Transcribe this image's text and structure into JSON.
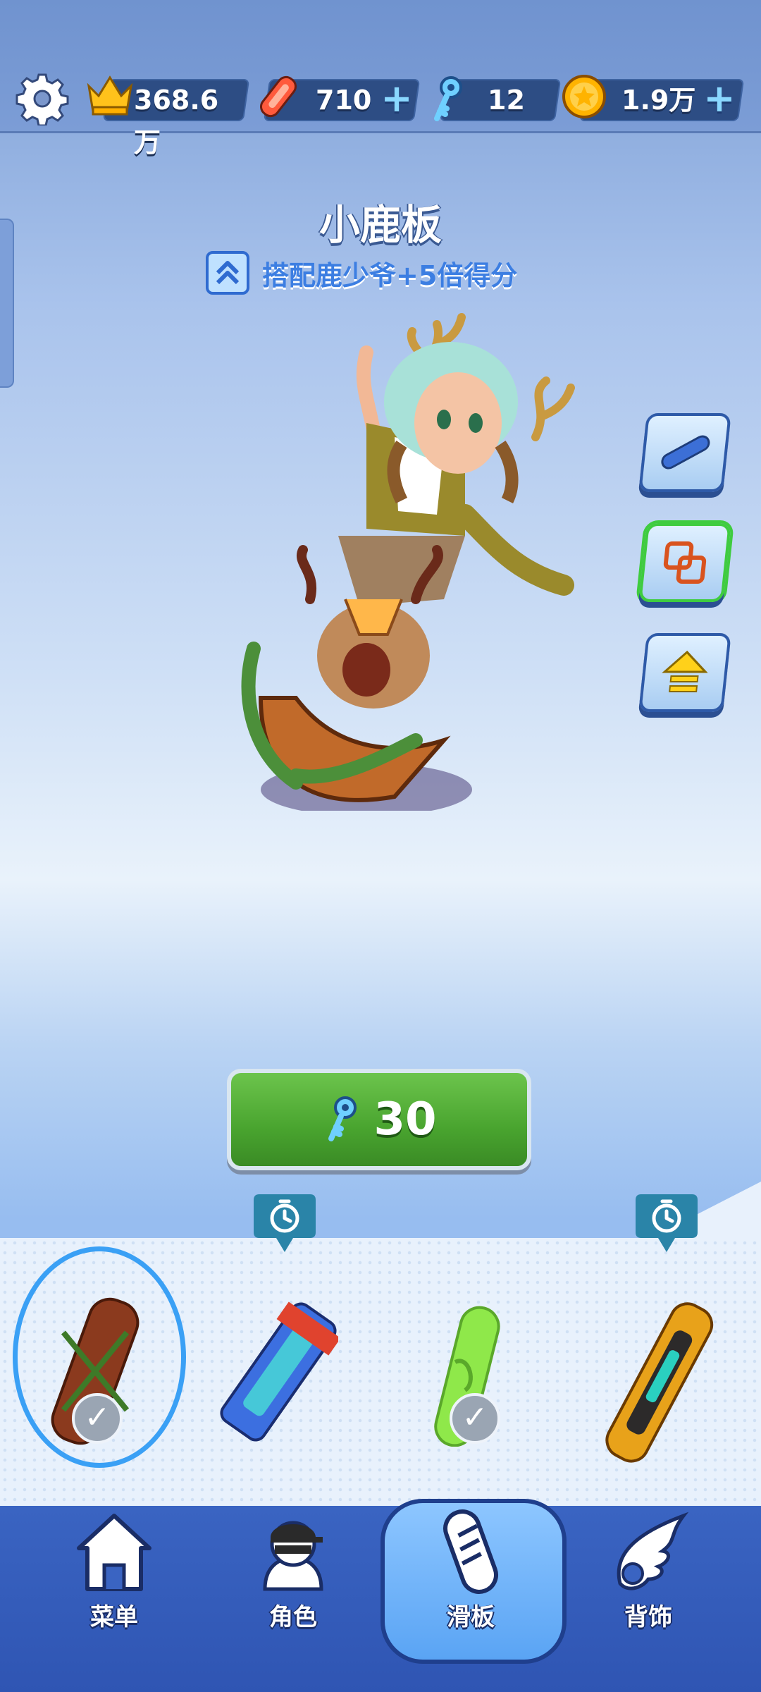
{
  "topbar": {
    "score": "368.6万",
    "boards": "710",
    "keys": "12",
    "coins": "1.9万",
    "plus": "+"
  },
  "item": {
    "name": "小鹿板",
    "bonus": "搭配鹿少爷+5倍得分"
  },
  "purchase": {
    "price": "30",
    "currency_icon": "key-icon"
  },
  "shelf": {
    "items": [
      {
        "name": "deer-sled-board",
        "selected": true,
        "owned": true,
        "timed": false
      },
      {
        "name": "blue-tech-board",
        "selected": false,
        "owned": false,
        "timed": true
      },
      {
        "name": "green-slime-board",
        "selected": false,
        "owned": true,
        "timed": false
      },
      {
        "name": "golden-rocket-board",
        "selected": false,
        "owned": false,
        "timed": true
      }
    ]
  },
  "nav": {
    "menu": "菜单",
    "character": "角色",
    "board": "滑板",
    "back_accessory": "背饰",
    "active": "board"
  },
  "colors": {
    "buy_green": "#49a42f",
    "nav_blue": "#2f55b3",
    "selection_ring": "#3aa0f5"
  }
}
